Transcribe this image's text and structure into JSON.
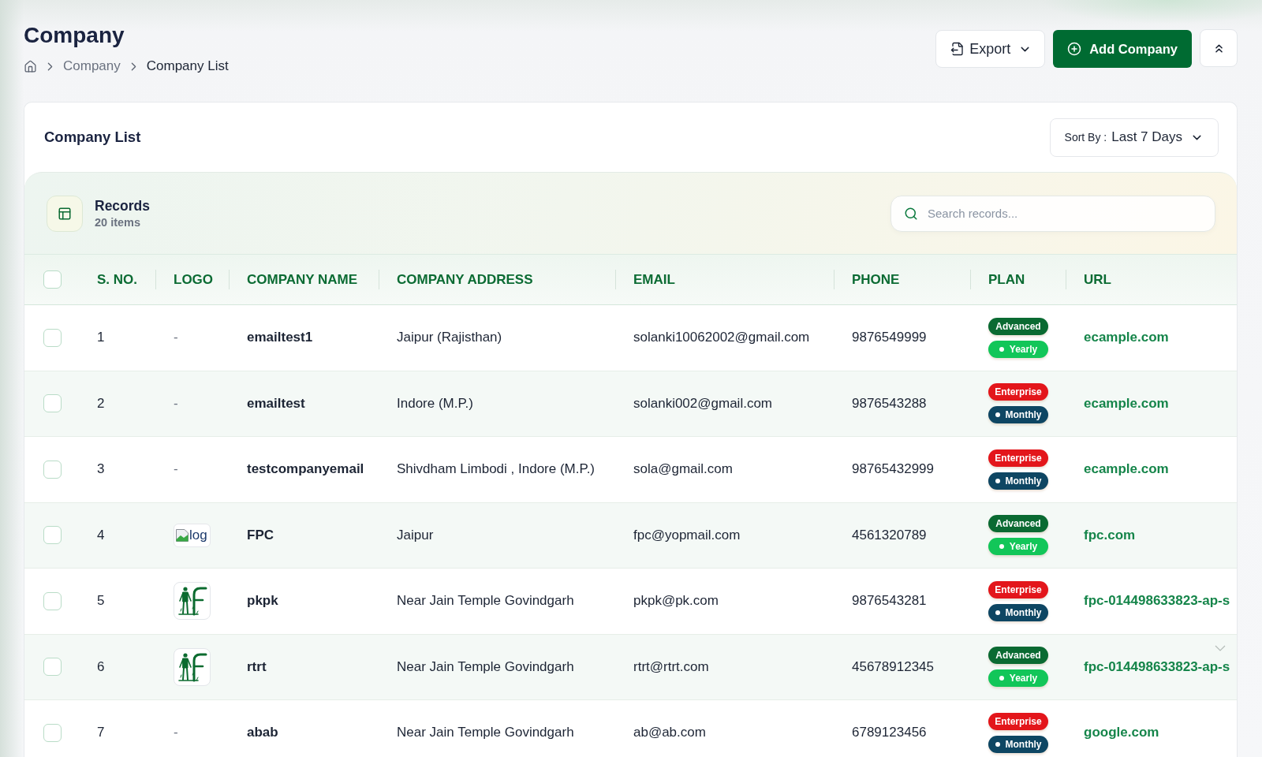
{
  "page": {
    "title": "Company",
    "breadcrumb": [
      {
        "label": "Company",
        "current": false
      },
      {
        "label": "Company List",
        "current": true
      }
    ]
  },
  "actions": {
    "export": "Export",
    "add": "Add Company"
  },
  "card": {
    "title": "Company List",
    "sort": {
      "label": "Sort By :",
      "value": "Last 7 Days"
    }
  },
  "records": {
    "title": "Records",
    "count": "20 items",
    "search": {
      "placeholder": "Search records..."
    }
  },
  "table": {
    "select_all": {
      "checked": false
    },
    "columns": [
      "S. NO.",
      "LOGO",
      "COMPANY NAME",
      "COMPANY ADDRESS",
      "EMAIL",
      "PHONE",
      "PLAN",
      "URL"
    ],
    "rows": [
      {
        "checked": false,
        "no": "1",
        "logo": {
          "kind": "none",
          "text": "-"
        },
        "name": "emailtest1",
        "address": "Jaipur (Rajisthan)",
        "email": "solanki10062002@gmail.com",
        "phone": "9876549999",
        "plan": {
          "label": "Advanced",
          "color": "#0a6a32"
        },
        "billing": {
          "label": "Yearly",
          "color": "#12c659"
        },
        "url": "ecample.com"
      },
      {
        "checked": false,
        "no": "2",
        "logo": {
          "kind": "none",
          "text": "-"
        },
        "name": "emailtest",
        "address": "Indore (M.P.)",
        "email": "solanki002@gmail.com",
        "phone": "9876543288",
        "plan": {
          "label": "Enterprise",
          "color": "#e3161b"
        },
        "billing": {
          "label": "Monthly",
          "color": "#0e4663"
        },
        "url": "ecample.com"
      },
      {
        "checked": false,
        "no": "3",
        "logo": {
          "kind": "none",
          "text": "-"
        },
        "name": "testcompanyemail",
        "address": "Shivdham Limbodi , Indore (M.P.)",
        "email": "sola@gmail.com",
        "phone": "98765432999",
        "plan": {
          "label": "Enterprise",
          "color": "#e3161b"
        },
        "billing": {
          "label": "Monthly",
          "color": "#0e4663"
        },
        "url": "ecample.com"
      },
      {
        "checked": false,
        "no": "4",
        "logo": {
          "kind": "broken",
          "text": "log"
        },
        "name": "FPC",
        "address": "Jaipur",
        "email": "fpc@yopmail.com",
        "phone": "4561320789",
        "plan": {
          "label": "Advanced",
          "color": "#0a6a32"
        },
        "billing": {
          "label": "Yearly",
          "color": "#12c659"
        },
        "url": "fpc.com"
      },
      {
        "checked": false,
        "no": "5",
        "logo": {
          "kind": "image"
        },
        "name": "pkpk",
        "address": "Near Jain Temple Govindgarh",
        "email": "pkpk@pk.com",
        "phone": "9876543281",
        "plan": {
          "label": "Enterprise",
          "color": "#e3161b"
        },
        "billing": {
          "label": "Monthly",
          "color": "#0e4663"
        },
        "url": "fpc-014498633823-ap-s"
      },
      {
        "checked": false,
        "no": "6",
        "logo": {
          "kind": "image"
        },
        "name": "rtrt",
        "address": "Near Jain Temple Govindgarh",
        "email": "rtrt@rtrt.com",
        "phone": "45678912345",
        "plan": {
          "label": "Advanced",
          "color": "#0a6a32"
        },
        "billing": {
          "label": "Yearly",
          "color": "#12c659"
        },
        "url": "fpc-014498633823-ap-s"
      },
      {
        "checked": false,
        "no": "7",
        "logo": {
          "kind": "none",
          "text": "-"
        },
        "name": "abab",
        "address": "Near Jain Temple Govindgarh",
        "email": "ab@ab.com",
        "phone": "6789123456",
        "plan": {
          "label": "Enterprise",
          "color": "#e3161b"
        },
        "billing": {
          "label": "Monthly",
          "color": "#0e4663"
        },
        "url": "google.com"
      }
    ]
  }
}
